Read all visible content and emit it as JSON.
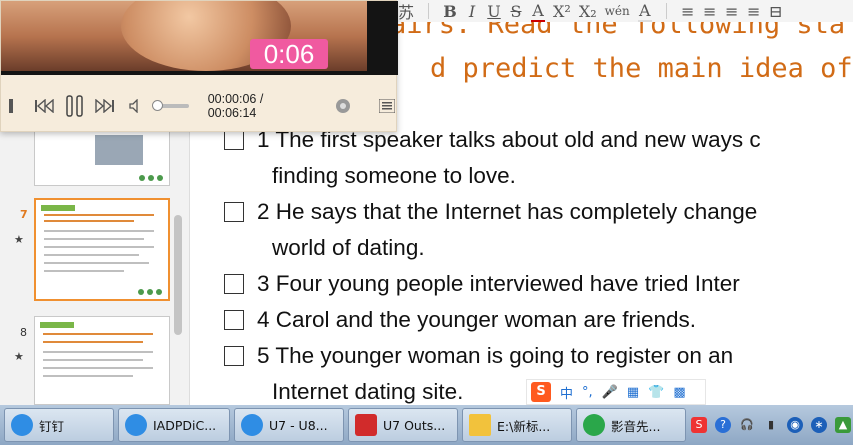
{
  "ribbon": {
    "tools": [
      "苏",
      "B",
      "I",
      "U",
      "S",
      "A",
      "X²",
      "X₂",
      "wén",
      "A"
    ],
    "align_tools": [
      "≡",
      "≡",
      "≡",
      "≡",
      "⊟"
    ]
  },
  "slide": {
    "title_line1": "airs. Read the following sta",
    "title_line2": "d predict the main idea of F",
    "items": [
      {
        "text": "1 The first speaker talks about old and new ways c",
        "cont": "finding someone to love."
      },
      {
        "text": "2 He says that the Internet has completely change",
        "cont": "world of dating."
      },
      {
        "text": "3 Four young people interviewed have tried Inter",
        "cont": ""
      },
      {
        "text": "4 Carol and the younger woman are friends.",
        "cont": ""
      },
      {
        "text": "5 The younger woman is going to register on an",
        "cont": "Internet dating site."
      }
    ]
  },
  "panel": {
    "thumbs": [
      {
        "num": "",
        "star": ""
      },
      {
        "num": "7",
        "star": "★"
      },
      {
        "num": "8",
        "star": "★"
      }
    ]
  },
  "player": {
    "time_badge": "0:06",
    "current_time": "00:00:06",
    "separator": "/",
    "total_time": "00:06:14"
  },
  "ime": {
    "logo": "S",
    "items": [
      "中",
      "°,",
      "🎤",
      "▦",
      "👕",
      "▩"
    ]
  },
  "taskbar": {
    "tasks": [
      {
        "label": "钉钉",
        "icon_color": "#2f8de4"
      },
      {
        "label": "IADPDiC...",
        "icon_color": "#2f8de4"
      },
      {
        "label": "U7 - U8...",
        "icon_color": "#2f8de4"
      },
      {
        "label": "U7 Outs...",
        "icon_color": "#d12b2b"
      },
      {
        "label": "E:\\新标...",
        "icon_color": "#f2c23c"
      },
      {
        "label": "影音先...",
        "icon_color": "#2aa74a"
      }
    ],
    "tray": [
      "S",
      "?",
      "🎧",
      "▮",
      "◉",
      "∗",
      "▲"
    ]
  },
  "colors": {
    "title": "#d16b16",
    "active_thumb": "#f09030",
    "time_badge": "#f05aa0"
  }
}
